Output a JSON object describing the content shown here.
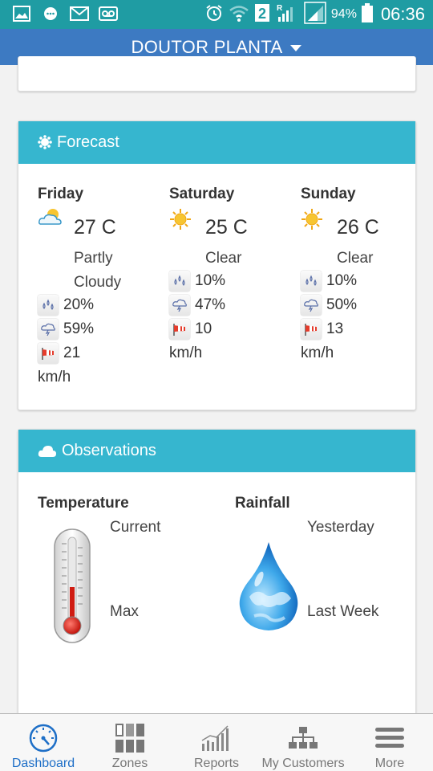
{
  "status_bar": {
    "battery": "94%",
    "time": "06:36"
  },
  "app": {
    "title": "DOUTOR PLANTA"
  },
  "forecast": {
    "title": "Forecast",
    "days": [
      {
        "day": "Friday",
        "icon": "partly-cloudy-icon",
        "temp": "27 C",
        "desc_line1": "Partly",
        "desc_line2": "Cloudy",
        "precip": "20%",
        "storm": "59%",
        "wind": "21",
        "wind_unit": "km/h"
      },
      {
        "day": "Saturday",
        "icon": "sun-icon",
        "temp": "25 C",
        "desc_line1": "Clear",
        "desc_line2": "",
        "precip": "10%",
        "storm": "47%",
        "wind": "10",
        "wind_unit": "km/h"
      },
      {
        "day": "Sunday",
        "icon": "sun-icon",
        "temp": "26 C",
        "desc_line1": "Clear",
        "desc_line2": "",
        "precip": "10%",
        "storm": "50%",
        "wind": "13",
        "wind_unit": "km/h"
      }
    ]
  },
  "observations": {
    "title": "Observations",
    "temperature": {
      "heading": "Temperature",
      "current_label": "Current",
      "max_label": "Max"
    },
    "rainfall": {
      "heading": "Rainfall",
      "yesterday_label": "Yesterday",
      "last_week_label": "Last Week"
    }
  },
  "nav": [
    {
      "label": "Dashboard",
      "icon": "clock-gauge-icon",
      "active": true
    },
    {
      "label": "Zones",
      "icon": "grid-icon",
      "active": false
    },
    {
      "label": "Reports",
      "icon": "bar-chart-icon",
      "active": false
    },
    {
      "label": "My Customers",
      "icon": "org-chart-icon",
      "active": false
    },
    {
      "label": "More",
      "icon": "menu-icon",
      "active": false
    }
  ],
  "colors": {
    "status_bar": "#1f9ca3",
    "app_bar": "#3d7ac2",
    "card_header": "#36b6cf",
    "nav_active": "#1e6fc7"
  }
}
